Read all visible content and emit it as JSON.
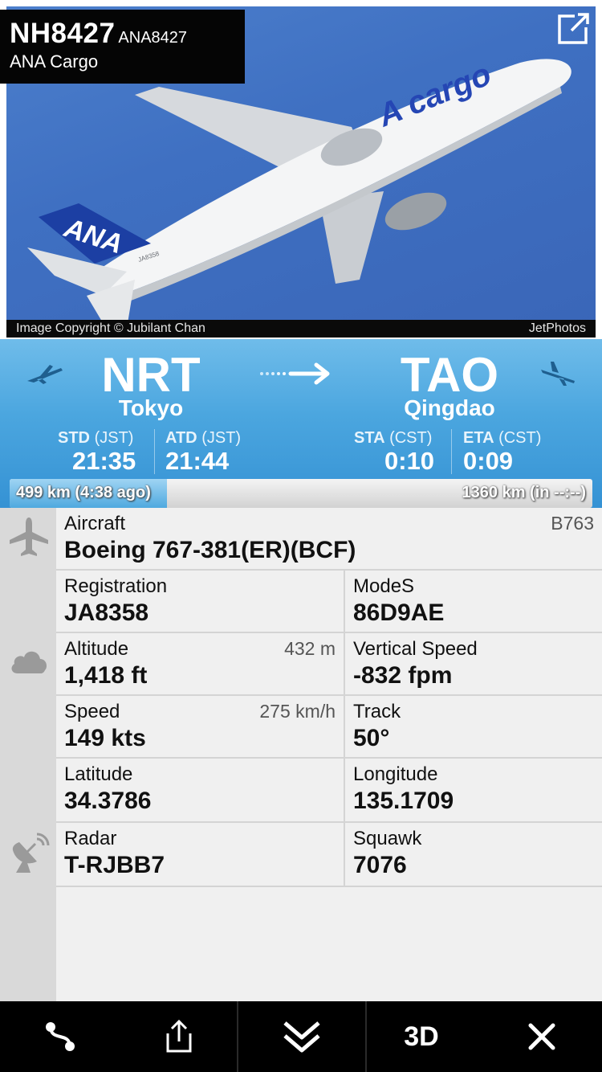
{
  "flight": {
    "number": "NH8427",
    "callsign": "ANA8427",
    "airline": "ANA Cargo"
  },
  "photo": {
    "copyright": "Image Copyright © Jubilant Chan",
    "source": "JetPhotos",
    "livery_text": "A cargo",
    "tail_text": "ANA",
    "reg_text": "JA8358"
  },
  "route": {
    "origin": {
      "code": "NRT",
      "city": "Tokyo"
    },
    "destination": {
      "code": "TAO",
      "city": "Qingdao"
    },
    "std": {
      "label": "STD",
      "tz": "(JST)",
      "time": "21:35"
    },
    "atd": {
      "label": "ATD",
      "tz": "(JST)",
      "time": "21:44"
    },
    "sta": {
      "label": "STA",
      "tz": "(CST)",
      "time": "0:10"
    },
    "eta": {
      "label": "ETA",
      "tz": "(CST)",
      "time": "0:09"
    }
  },
  "progress": {
    "fraction": 0.27,
    "flown_text": "499 km (4:38 ago)",
    "remaining_text": "1360 km (in --:--)"
  },
  "aircraft": {
    "label": "Aircraft",
    "type_code": "B763",
    "model": "Boeing 767-381(ER)(BCF)"
  },
  "details": {
    "registration": {
      "label": "Registration",
      "value": "JA8358"
    },
    "modes": {
      "label": "ModeS",
      "value": "86D9AE"
    },
    "altitude": {
      "label": "Altitude",
      "value": "1,418 ft",
      "alt": "432 m"
    },
    "vertical_speed": {
      "label": "Vertical Speed",
      "value": "-832 fpm"
    },
    "speed": {
      "label": "Speed",
      "value": "149 kts",
      "alt": "275 km/h"
    },
    "track": {
      "label": "Track",
      "value": "50°"
    },
    "latitude": {
      "label": "Latitude",
      "value": "34.3786"
    },
    "longitude": {
      "label": "Longitude",
      "value": "135.1709"
    },
    "radar": {
      "label": "Radar",
      "value": "T-RJBB7"
    },
    "squawk": {
      "label": "Squawk",
      "value": "7076"
    }
  },
  "tabbar": {
    "three_d_label": "3D"
  },
  "colors": {
    "route_band": "#4ba6df",
    "panel": "#f0f0f0",
    "gutter": "#d9d9d9"
  }
}
